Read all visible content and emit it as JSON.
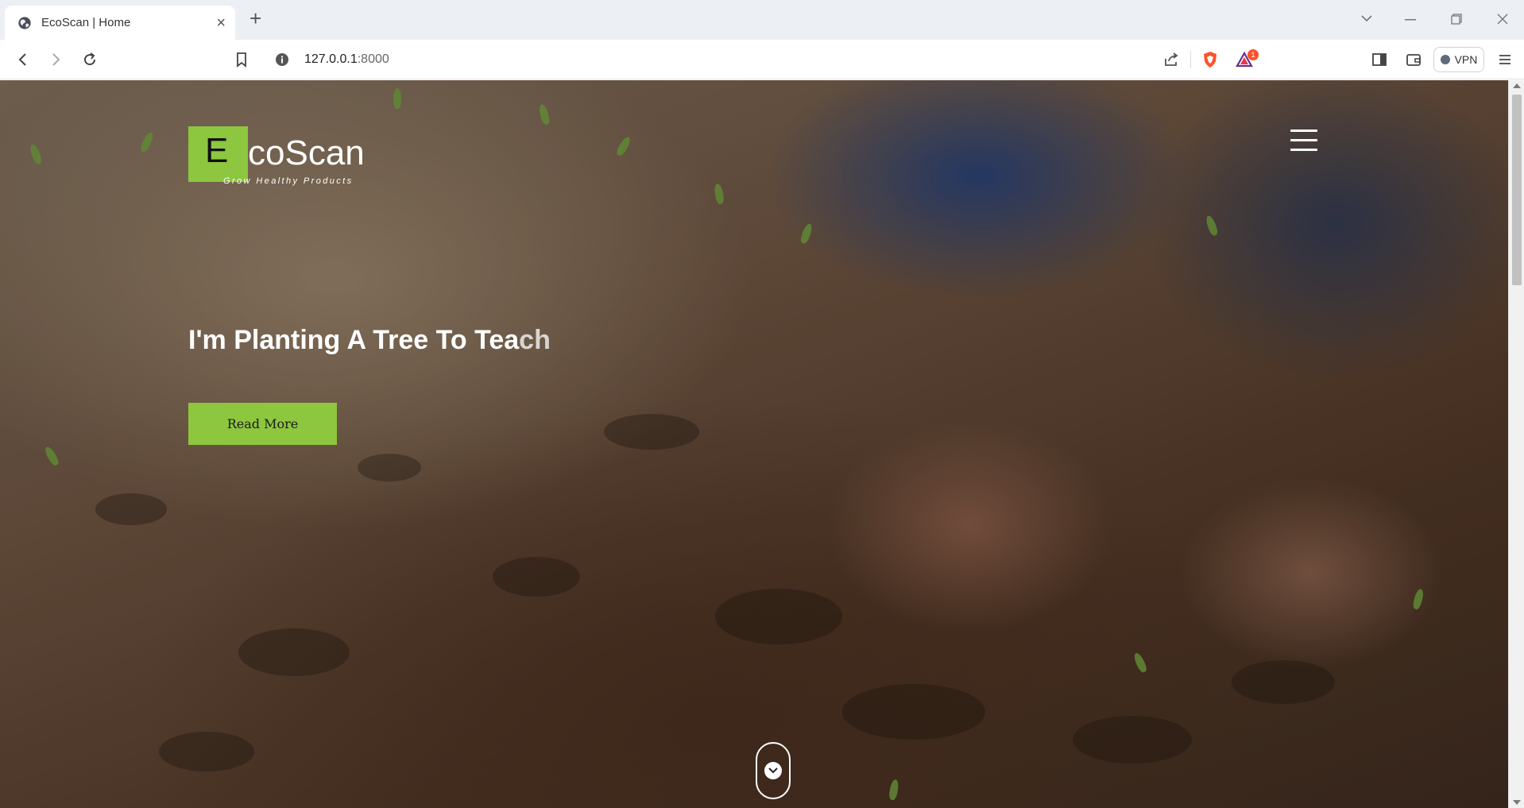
{
  "browser": {
    "tab_title": "EcoScan | Home",
    "url_host": "127.0.0.1",
    "url_port": ":8000",
    "vpn_label": "VPN",
    "rewards_badge": "1"
  },
  "site": {
    "logo_letter": "E",
    "logo_rest": "coScan",
    "tagline": "Grow Healthy Products",
    "headline_main": "I'm Planting A Tree To Tea",
    "headline_fade": "ch",
    "read_more_label": "Read More"
  },
  "colors": {
    "accent": "#8dc63f",
    "brave_orange": "#fb542b",
    "tab_strip": "#eceff3"
  }
}
